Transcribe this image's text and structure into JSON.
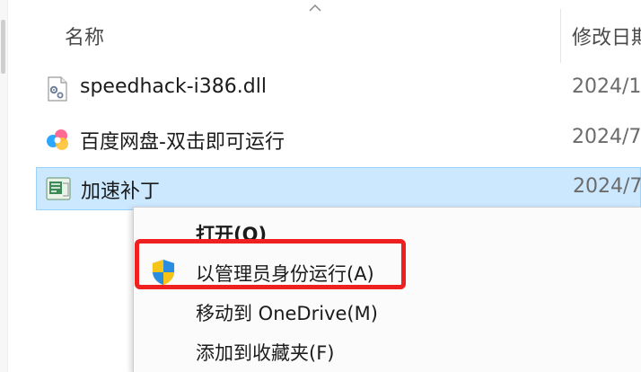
{
  "header": {
    "name_column": "名称",
    "date_column": "修改日期"
  },
  "files": [
    {
      "name": "speedhack-i386.dll",
      "date": "2024/1",
      "icon": "dll-gear-icon"
    },
    {
      "name": "百度网盘-双击即可运行",
      "date": "2024/7",
      "icon": "baidu-netdisk-icon"
    },
    {
      "name": "加速补丁",
      "date": "2024/7",
      "icon": "patch-app-icon",
      "selected": true
    }
  ],
  "context_menu": {
    "items": [
      {
        "label": "打开(O)",
        "bold": true
      },
      {
        "label": "以管理员身份运行(A)",
        "icon": "uac-shield-icon"
      },
      {
        "label": "移动到 OneDrive(M)"
      },
      {
        "label": "添加到收藏夹(F)"
      }
    ]
  },
  "colors": {
    "selection": "#cce8ff",
    "highlight_box": "#ee2020"
  }
}
